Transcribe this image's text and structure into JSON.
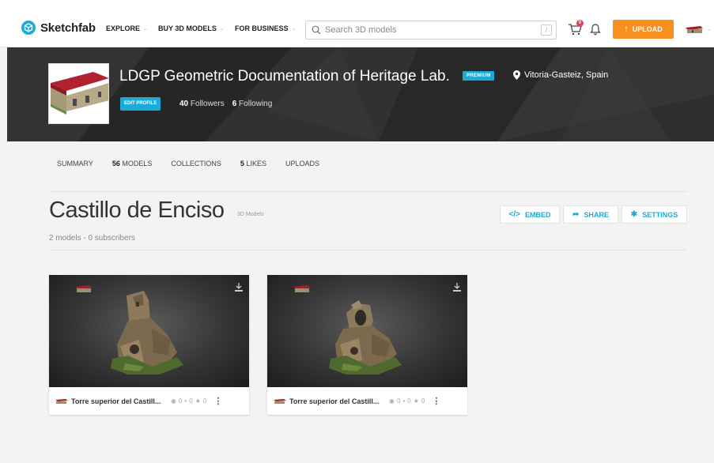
{
  "nav": {
    "brand": "Sketchfab",
    "items": [
      {
        "label": "EXPLORE"
      },
      {
        "label": "BUY 3D MODELS"
      },
      {
        "label": "FOR BUSINESS"
      }
    ],
    "search_placeholder": "Search 3D models",
    "search_value": "",
    "search_shortcut": "/",
    "cart_badge": "0",
    "upload_label": "UPLOAD",
    "upload_arrow": "↑",
    "chevron": "⌄",
    "accent_color": "#1caad9",
    "upload_color": "#f7901e",
    "icons": [
      "sketchfab-logo-icon",
      "search-icon",
      "cart-icon",
      "bell-icon",
      "upload-arrow-icon"
    ]
  },
  "profile": {
    "name": "LDGP Geometric Documentation of Heritage Lab.",
    "badge": "PREMIUM",
    "location": "Vitoria-Gasteiz, Spain",
    "edit_label": "EDIT PROFILE",
    "followers_count": "40",
    "followers_label": "Followers",
    "following_count": "6",
    "following_label": "Following"
  },
  "tabs": [
    {
      "count": "",
      "label": "SUMMARY"
    },
    {
      "count": "56",
      "label": "MODELS"
    },
    {
      "count": "",
      "label": "COLLECTIONS"
    },
    {
      "count": "5",
      "label": "LIKES"
    },
    {
      "count": "",
      "label": "UPLOADS"
    }
  ],
  "collection": {
    "title": "Castillo de Enciso",
    "subtitle": "3D Models",
    "meta": "2 models - 0 subscribers",
    "actions": [
      {
        "icon": "</>",
        "label": "EMBED"
      },
      {
        "icon": "➦",
        "label": "SHARE"
      },
      {
        "icon": "✱",
        "label": "SETTINGS"
      }
    ]
  },
  "models": [
    {
      "name": "Torre superior del Castill...",
      "views": "0",
      "comments": "0",
      "likes": "0",
      "more": "⋮"
    },
    {
      "name": "Torre superior del Castill...",
      "views": "0",
      "comments": "0",
      "likes": "0",
      "more": "⋮"
    }
  ],
  "stat_icons": {
    "views": "◉",
    "comments": "▪",
    "likes": "★"
  }
}
